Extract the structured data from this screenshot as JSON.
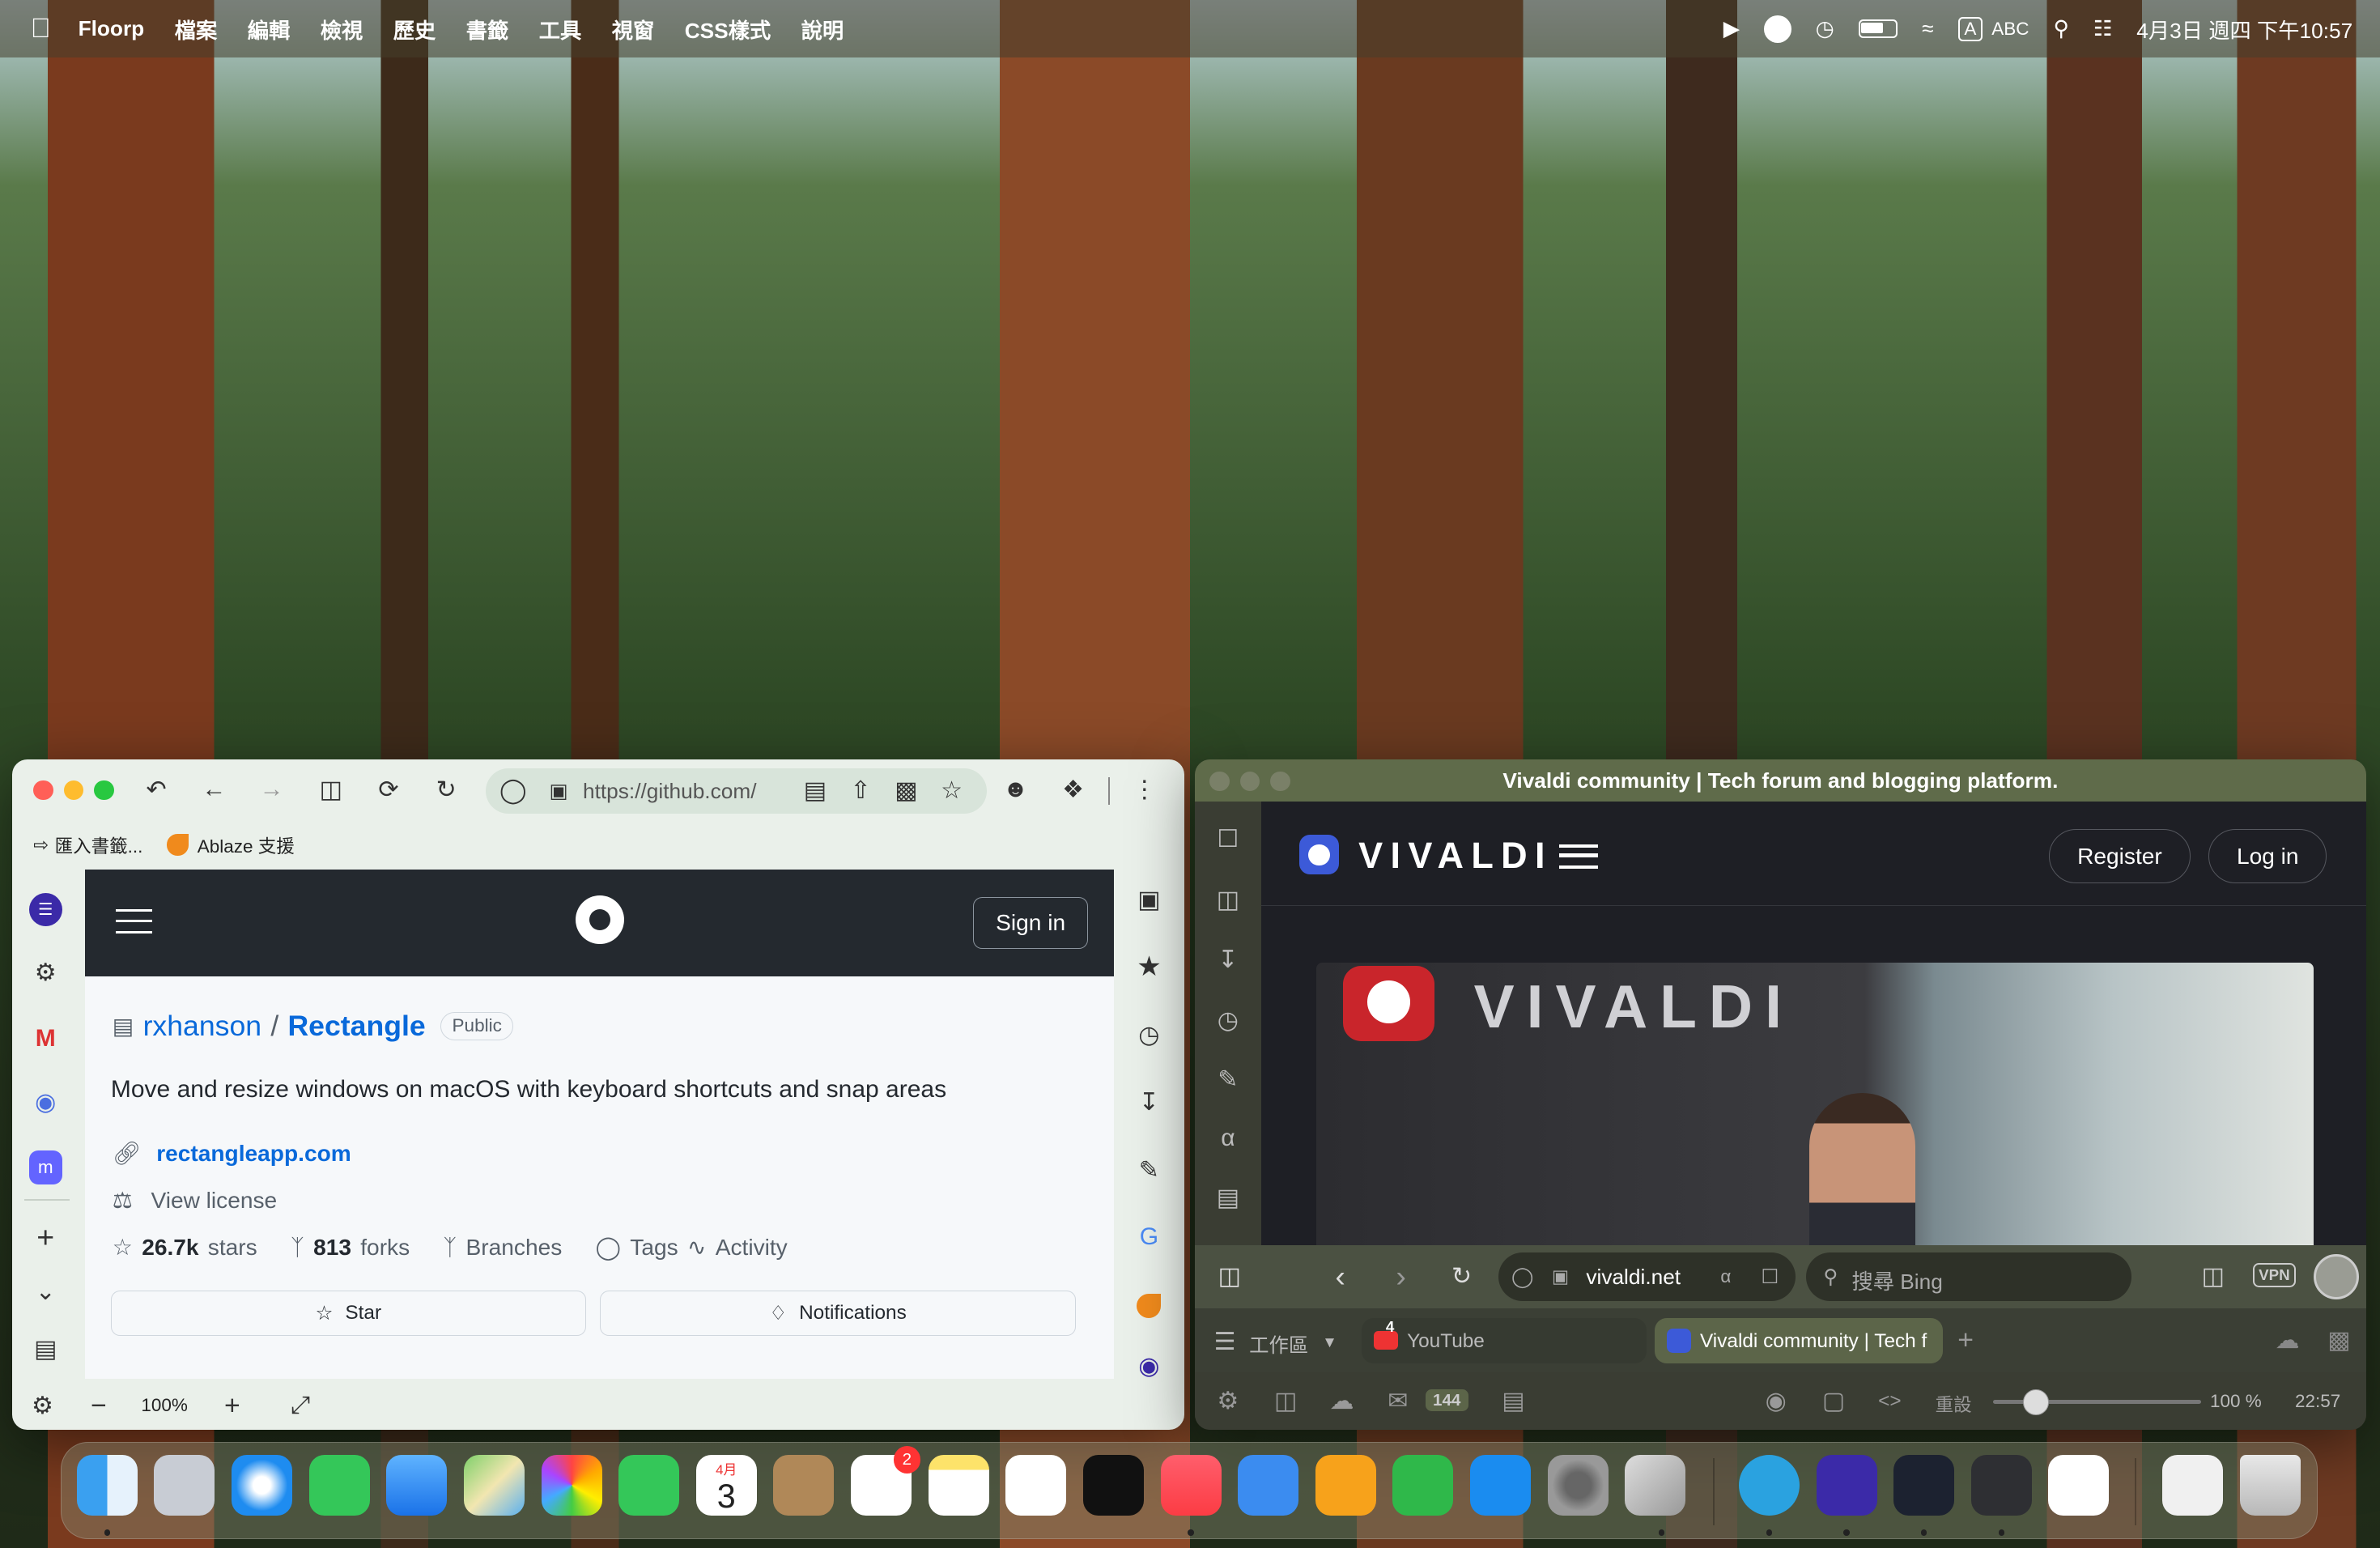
{
  "menubar": {
    "app": "Floorp",
    "items": [
      "檔案",
      "編輯",
      "檢視",
      "歷史",
      "書籤",
      "工具",
      "視窗",
      "CSS樣式",
      "說明"
    ],
    "input": "A",
    "input_label": "ABC",
    "clock": "4月3日 週四 下午10:57"
  },
  "floorp": {
    "url": "https://github.com/",
    "bookmarks": [
      {
        "label": "匯入書籤..."
      },
      {
        "label": "Ablaze 支援"
      }
    ],
    "zoom": "100%",
    "github": {
      "sign_in": "Sign in",
      "owner": "rxhanson",
      "sep": "/",
      "repo": "Rectangle",
      "visibility": "Public",
      "description": "Move and resize windows on macOS with keyboard shortcuts and snap areas",
      "website": "rectangleapp.com",
      "license": "View license",
      "stars": "26.7k",
      "stars_label": "stars",
      "forks": "813",
      "forks_label": "forks",
      "branches": "Branches",
      "tags": "Tags",
      "activity": "Activity",
      "star_btn": "Star",
      "notif_btn": "Notifications"
    }
  },
  "vivaldi": {
    "title": "Vivaldi community | Tech forum and blogging platform.",
    "brand": "VIVALDI",
    "register": "Register",
    "login": "Log in",
    "sign": "VIVALDI",
    "address": "vivaldi.net",
    "search_placeholder": "搜尋 Bing",
    "vpn": "VPN",
    "workspace": "工作區",
    "tabs": [
      {
        "label": "YouTube",
        "badge": "4"
      },
      {
        "label": "Vivaldi community | Tech f"
      }
    ],
    "mail_count": "144",
    "reset": "重設",
    "zoom": "100 %",
    "time": "22:57"
  },
  "dock": {
    "calendar_month": "4月",
    "calendar_day": "3",
    "reminders_badge": "2"
  },
  "colors": {
    "accent": "#0969da",
    "github_dark": "#24292f",
    "vivaldi_red": "#ef3939"
  }
}
